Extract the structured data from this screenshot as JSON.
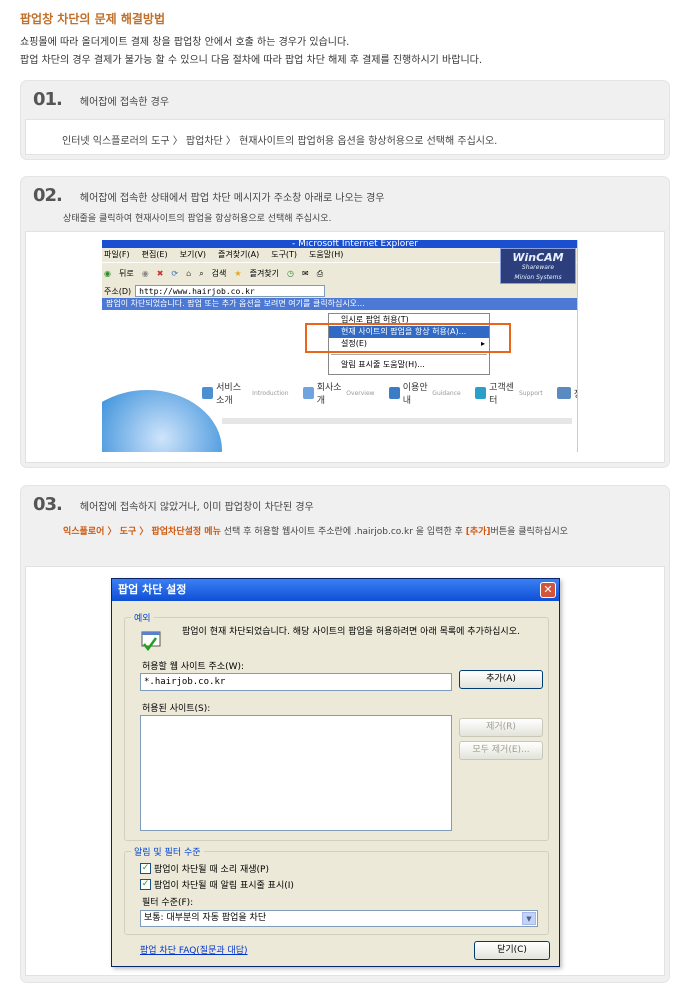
{
  "page": {
    "title": "팝업창 차단의 문제 해결방법",
    "intro_1": "쇼핑몰에 따라 올더게이트 결제 창을 팝업창 안에서 호출 하는 경우가 있습니다.",
    "intro_2": "팝업 차단의 경우 결제가 불가능 할 수 있으니 다음 절차에 따라 팝업 차단 해제 후 결제를 진행하시기 바랍니다."
  },
  "sections": [
    {
      "num": "01.",
      "title": "헤어잡에  접속한  경우",
      "body": "인터넷 익스플로러의 도구 〉 팝업차단 〉 현재사이트의 팝업허용 옵션을 항상허용으로 선택해 주십시오."
    },
    {
      "num": "02.",
      "title": "헤어잡에   접속한 상태에서 팝업 차단 메시지가 주소창 아래로 나오는 경우",
      "body": "상태줄을 클릭하여 현재사이트의 팝업을 항상허용으로 선택해 주십시오."
    },
    {
      "num": "03.",
      "title": "헤어잡에  접속하지 않았거나, 이미 팝업창이 차단된 경우",
      "body_orange_1": "익스플로어 〉 도구 〉 팝업차단설정 메뉴",
      "body_mid": " 선택 후 허용할 웹사이트 주소란에  .hairjob.co.kr 을 입력한 후 ",
      "body_orange_2": "[추가]",
      "body_end": "버튼을 클릭하십시오"
    }
  ],
  "ie_screenshot": {
    "window_title": "- Microsoft Internet Explorer",
    "menu": [
      "파일(F)",
      "편집(E)",
      "보기(V)",
      "즐겨찾기(A)",
      "도구(T)",
      "도움말(H)"
    ],
    "toolbar": [
      "뒤로",
      "",
      "",
      "",
      "",
      "검색",
      "즐겨찾기",
      "",
      "",
      "",
      ""
    ],
    "address_label": "주소(D)",
    "address_value": "http://www.hairjob.co.kr",
    "info_bar": "팝업이 차단되었습니다. 팝업 또는 추가 옵션을 보려면 여기를 클릭하십시오...",
    "logo_main": "WinCAM",
    "logo_sub1": "Shareware",
    "logo_sub2": "Minion Systems",
    "context_menu": [
      "임시로 팝업 허용(T)",
      "현재 사이트의 팝업을 항상 허용(A)...",
      "설정(E)",
      "알림 표시줄 도움말(H)..."
    ],
    "nav": [
      {
        "label": "서비스소개",
        "sub": "Introduction"
      },
      {
        "label": "회사소개",
        "sub": "Overview"
      },
      {
        "label": "이용안내",
        "sub": "Guidance"
      },
      {
        "label": "고객센터",
        "sub": "Support"
      },
      {
        "label": "정",
        "sub": ""
      }
    ]
  },
  "dialog": {
    "title": "팝업 차단 설정",
    "exceptions_group": "예외",
    "info_text": "팝업이 현재 차단되었습니다. 해당 사이트의 팝업을 허용하려면 아래 목록에 추가하십시오.",
    "address_label": "허용할 웹 사이트 주소(W):",
    "address_value": "*.hairjob.co.kr",
    "add_button": "추가(A)",
    "allowed_label": "허용된 사이트(S):",
    "remove_button": "제거(R)",
    "remove_all_button": "모두 제거(E)...",
    "notify_group": "알림 및 필터 수준",
    "check_sound": "팝업이 차단될 때 소리 재생(P)",
    "check_infobar": "팝업이 차단될 때 알림 표시줄 표시(I)",
    "filter_label": "필터 수준(F):",
    "filter_value": "보통: 대부분의 자동 팝업을 차단",
    "faq_link": "팝업 차단 FAQ(질문과 대답)",
    "close_button": "닫기(C)"
  }
}
